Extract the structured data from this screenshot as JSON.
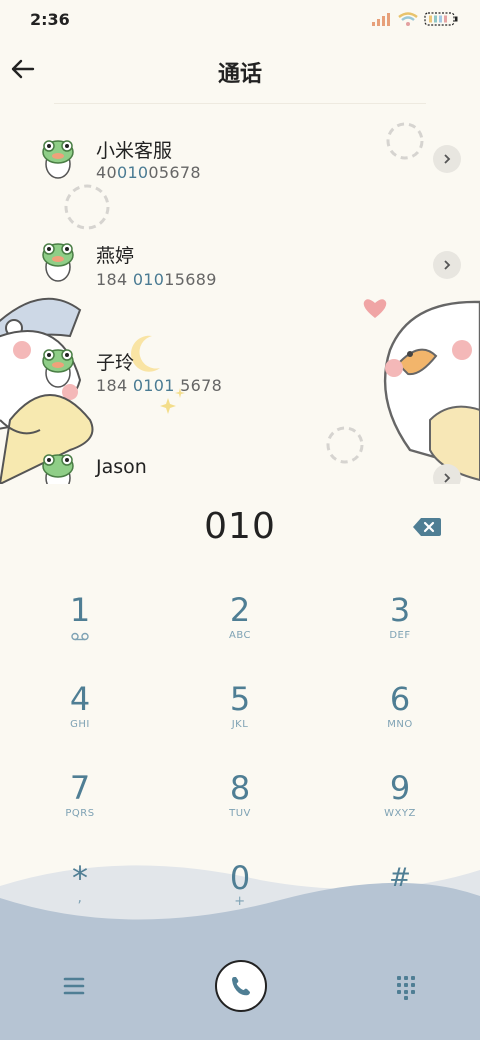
{
  "status": {
    "time": "2:36"
  },
  "header": {
    "title": "通话"
  },
  "contacts": [
    {
      "name": "小米客服",
      "num_pre": "40",
      "num_hl": "010",
      "num_post": "05678"
    },
    {
      "name": "燕婷",
      "num_pre": "184 ",
      "num_hl": "010",
      "num_post": "15689"
    },
    {
      "name": "子玲",
      "num_pre": "184 ",
      "num_hl": "0101",
      "num_post": " 5678"
    },
    {
      "name": "Jason",
      "num_pre": "",
      "num_hl": "",
      "num_post": ""
    }
  ],
  "dial": {
    "digits": "010"
  },
  "keys": [
    {
      "num": "1",
      "sub": ""
    },
    {
      "num": "2",
      "sub": "ABC"
    },
    {
      "num": "3",
      "sub": "DEF"
    },
    {
      "num": "4",
      "sub": "GHI"
    },
    {
      "num": "5",
      "sub": "JKL"
    },
    {
      "num": "6",
      "sub": "MNO"
    },
    {
      "num": "7",
      "sub": "PQRS"
    },
    {
      "num": "8",
      "sub": "TUV"
    },
    {
      "num": "9",
      "sub": "WXYZ"
    },
    {
      "num": "*",
      "sub": ","
    },
    {
      "num": "0",
      "sub": "+"
    },
    {
      "num": "#",
      "sub": ""
    }
  ],
  "colors": {
    "accent": "#4f7e94",
    "background": "#fbf9f2",
    "wave": "#b6c4d3"
  }
}
